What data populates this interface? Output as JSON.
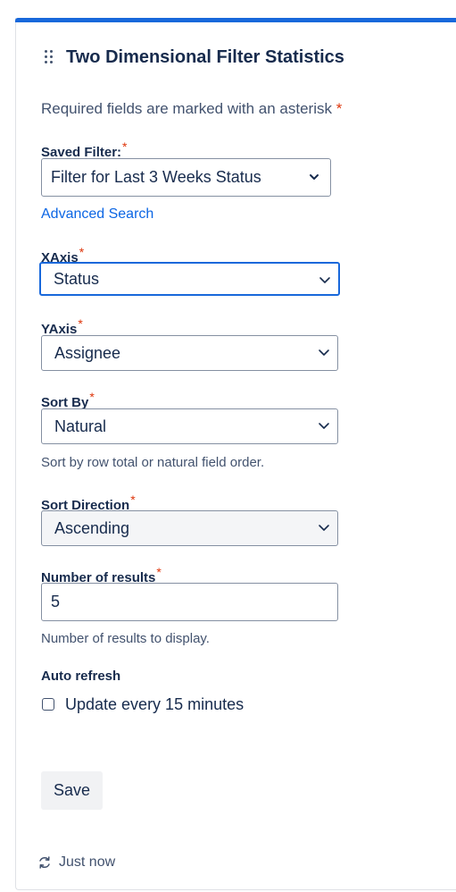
{
  "gadget": {
    "title": "Two Dimensional Filter Statistics",
    "required_note": "Required fields are marked with an asterisk",
    "asterisk": "*"
  },
  "saved_filter": {
    "label": "Saved Filter:",
    "value": "Filter for Last 3 Weeks Status",
    "advanced_search": "Advanced Search"
  },
  "x_axis": {
    "label": "XAxis",
    "value": "Status"
  },
  "y_axis": {
    "label": "YAxis",
    "value": "Assignee"
  },
  "sort_by": {
    "label": "Sort By",
    "value": "Natural",
    "help": "Sort by row total or natural field order."
  },
  "sort_direction": {
    "label": "Sort Direction",
    "value": "Ascending"
  },
  "num_results": {
    "label": "Number of results",
    "value": "5",
    "help": "Number of results to display."
  },
  "auto_refresh": {
    "label": "Auto refresh",
    "checkbox_label": "Update every 15 minutes",
    "checked": false
  },
  "actions": {
    "save_label": "Save"
  },
  "footer": {
    "refresh_status": "Just now"
  },
  "icons": {
    "drag": "drag-handle-icon",
    "chevron": "chevron-down-icon",
    "refresh": "refresh-icon"
  },
  "colors": {
    "accent": "#1868db",
    "required": "#de350b",
    "link": "#0c66e4"
  }
}
